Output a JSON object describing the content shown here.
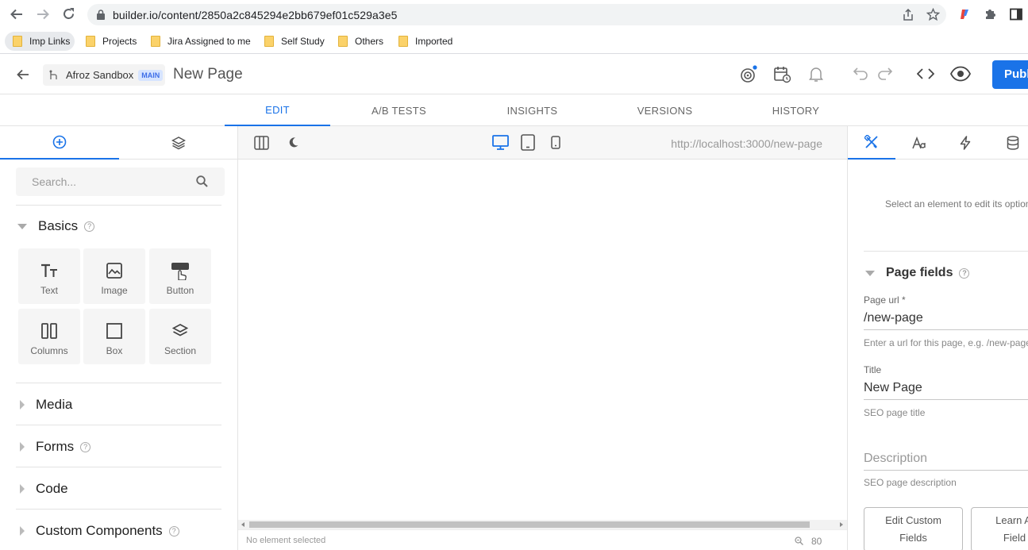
{
  "browser": {
    "url": "builder.io/content/2850a2c845294e2bb679ef01c529a3e5",
    "bookmarks": [
      "Imp Links",
      "Projects",
      "Jira Assigned to me",
      "Self Study",
      "Others",
      "Imported"
    ]
  },
  "header": {
    "space_name": "Afroz Sandbox",
    "branch_badge": "MAIN",
    "page_name": "New Page",
    "publish_label": "Publish"
  },
  "tabs": [
    "EDIT",
    "A/B TESTS",
    "INSIGHTS",
    "VERSIONS",
    "HISTORY"
  ],
  "active_tab": "EDIT",
  "left_panel": {
    "search_placeholder": "Search...",
    "sections": {
      "basics": "Basics",
      "media": "Media",
      "forms": "Forms",
      "code": "Code",
      "custom_components": "Custom Components"
    },
    "blocks": [
      "Text",
      "Image",
      "Button",
      "Columns",
      "Box",
      "Section"
    ]
  },
  "canvas": {
    "preview_url": "http://localhost:3000/new-page",
    "status": "No element selected",
    "zoom": "80"
  },
  "right_panel": {
    "hint": "Select an element to edit its options",
    "page_fields_title": "Page fields",
    "page_url_label": "Page url *",
    "page_url_value": "/new-page",
    "page_url_help": "Enter a url for this page, e.g. /new-page",
    "title_label": "Title",
    "title_value": "New Page",
    "title_help": "SEO page title",
    "description_placeholder": "Description",
    "description_help": "SEO page description",
    "edit_custom_fields_line1": "Edit Custom",
    "edit_custom_fields_line2": "Fields",
    "learn_fields_line1": "Learn Al",
    "learn_fields_line2": "Field"
  },
  "colors": {
    "accent": "#1a73e8",
    "folder": "#fbd26a"
  }
}
